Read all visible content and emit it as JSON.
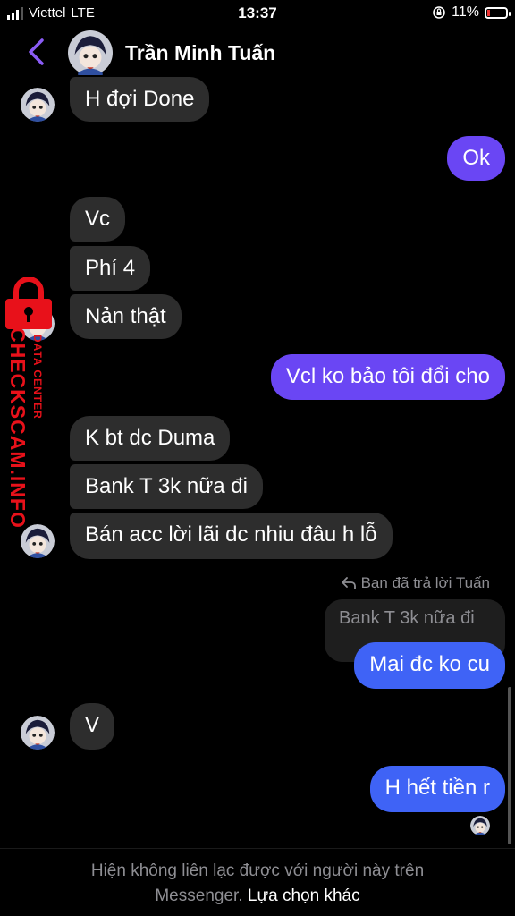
{
  "status": {
    "carrier": "Viettel",
    "network": "LTE",
    "time": "13:37",
    "battery": "11%"
  },
  "header": {
    "contact_name": "Trần Minh Tuấn"
  },
  "messages": [
    {
      "from": "them",
      "text": "H đợi Done"
    },
    {
      "from": "me",
      "text": "Ok"
    },
    {
      "from": "them",
      "text": "Vc"
    },
    {
      "from": "them",
      "text": "Phí 4"
    },
    {
      "from": "them",
      "text": "Nản thật"
    },
    {
      "from": "me",
      "text": "Vcl ko bảo tôi đổi cho"
    },
    {
      "from": "them",
      "text": "K bt dc Duma"
    },
    {
      "from": "them",
      "text": "Bank T 3k nữa đi"
    },
    {
      "from": "them",
      "text": "Bán acc lời lãi dc nhiu đâu h lỗ"
    },
    {
      "from": "me",
      "text": "Mai đc ko cu"
    },
    {
      "from": "them",
      "text": "V"
    },
    {
      "from": "me",
      "text": "H hết tiền r"
    }
  ],
  "reply": {
    "label": "Bạn đã trả lời Tuấn",
    "quoted": "Bank T 3k nữa đi"
  },
  "footer": {
    "notice_line1": "Hiện không liên lạc được với người này trên",
    "notice_line2": "Messenger.",
    "link": "Lựa chọn khác"
  },
  "watermark": {
    "text": "CHECKSCAM.INFO",
    "sub": "DATA CENTER"
  },
  "colors": {
    "incoming_bubble": "#2d2d2d",
    "outgoing_purple": "#6a46f4",
    "outgoing_blue": "#3f63f6",
    "accent": "#8b5cf6",
    "watermark_red": "#e8111a"
  }
}
